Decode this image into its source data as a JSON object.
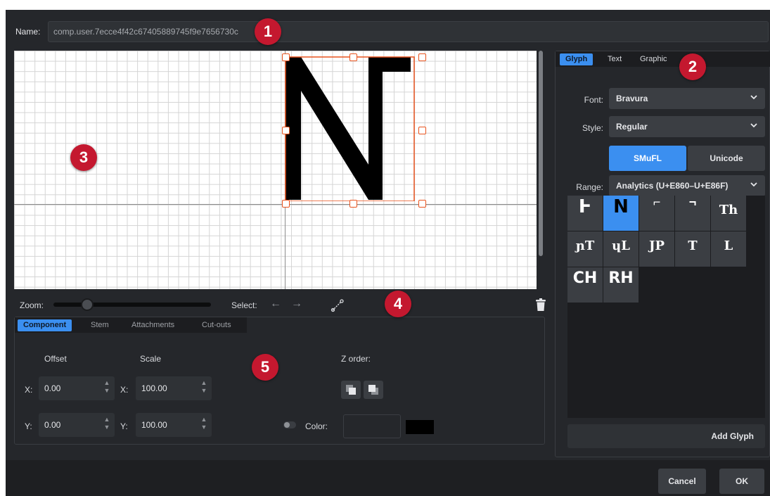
{
  "name_row": {
    "label": "Name:",
    "value": "comp.user.7ecce4f42c67405889745f9e7656730c"
  },
  "zoom_bar": {
    "zoom_label": "Zoom:",
    "zoom_level": 0.18,
    "select_label": "Select:",
    "prev_arrow": "←",
    "next_arrow": "→"
  },
  "props_tabs": [
    {
      "label": "Component",
      "active": true
    },
    {
      "label": "Stem",
      "active": false
    },
    {
      "label": "Attachments",
      "active": false
    },
    {
      "label": "Cut-outs",
      "active": false
    }
  ],
  "props": {
    "offset_label": "Offset",
    "scale_label": "Scale",
    "x_label": "X:",
    "y_label": "Y:",
    "offset_x": "0.00",
    "offset_y": "0.00",
    "scale_x": "100.00",
    "scale_y": "100.00",
    "z_order_label": "Z order:",
    "color_label": "Color:",
    "color_value": "#000000",
    "color_enabled": false
  },
  "right_tabs": [
    {
      "label": "Glyph",
      "active": true
    },
    {
      "label": "Text",
      "active": false
    },
    {
      "label": "Graphic",
      "active": false
    }
  ],
  "glyph_panel": {
    "font_label": "Font:",
    "font_value": "Bravura",
    "style_label": "Style:",
    "style_value": "Regular",
    "smufl_label": "SMuFL",
    "unicode_label": "Unicode",
    "mode_selected": "SMuFL",
    "range_label": "Range:",
    "range_value": "Analytics (U+E860–U+E86F)",
    "glyphs": [
      {
        "char": "Ⱶ",
        "selected": false
      },
      {
        "char": "N",
        "selected": true
      },
      {
        "char": "⌐",
        "selected": false
      },
      {
        "char": "¬",
        "selected": false
      },
      {
        "char": "Th",
        "selected": false
      },
      {
        "char": "ɲT",
        "selected": false
      },
      {
        "char": "ɥL",
        "selected": false
      },
      {
        "char": "JP",
        "selected": false
      },
      {
        "char": "T",
        "selected": false
      },
      {
        "char": "L",
        "selected": false
      },
      {
        "char": "CH",
        "selected": false
      },
      {
        "char": "RH",
        "selected": false
      }
    ],
    "add_glyph_label": "Add Glyph"
  },
  "footer": {
    "cancel_label": "Cancel",
    "ok_label": "OK"
  },
  "callouts": [
    "1",
    "2",
    "3",
    "4",
    "5"
  ],
  "colors": {
    "accent": "#3b8ff0",
    "callout": "#c4182f",
    "selection": "#e9531e",
    "panel": "#25272b"
  }
}
